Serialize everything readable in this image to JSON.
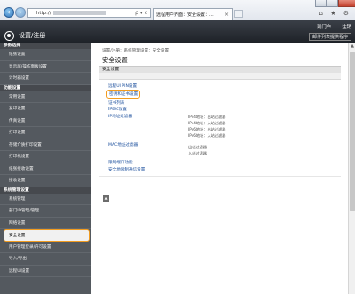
{
  "browser": {
    "url_prefix": "http://",
    "address_icons": "ρ ▾ c",
    "tab_title": "远程用户界面：安全设置：...",
    "tab_close": "×",
    "toolbar_icons": "⌂ ★ ⚙"
  },
  "header": {
    "app_title": "设置/注册",
    "link_portal": "到门户",
    "link_logout": "注销",
    "sub_link": "邮件列表提供程序"
  },
  "sidebar": {
    "groups": [
      {
        "title": "参数选择",
        "items": [
          "纸张设置",
          "显示屏/操作面板设置",
          "计时器设置"
        ]
      },
      {
        "title": "功能设置",
        "items": [
          "常用设置",
          "复印设置",
          "传真设置",
          "打印设置",
          "存储介质打印设置",
          "打印机设置",
          "纸张接收设置",
          "接收设置"
        ]
      },
      {
        "title": "系统管理设置",
        "items": [
          "系统管理",
          "部门ID管理/管理",
          "网络设置",
          "安全设置",
          "用户管理登录/许可设置",
          "导入/导出",
          "远程UI设置"
        ]
      }
    ],
    "active_item": "安全设置"
  },
  "main": {
    "breadcrumb": "设置/注册：系统管理设置：安全设置",
    "page_title": "安全设置",
    "bar1": "安全设置",
    "bar2": "",
    "links": [
      "远程UI PIN设置",
      "密钥和证书设置",
      "证书列表",
      "IPsec设置",
      "IP地址过滤器",
      "MAC地址过滤器",
      "限制端口功能",
      "安全地限制通信设置"
    ],
    "ip_filter_values": [
      "IPv4地址：出站过滤器",
      "IPv4地址：入站过滤器",
      "IPv6地址：出站过滤器",
      "IPv6地址：入站过滤器"
    ],
    "mac_filter_values": [
      "出站过滤器",
      "入站过滤器"
    ],
    "top_button": "▲"
  }
}
